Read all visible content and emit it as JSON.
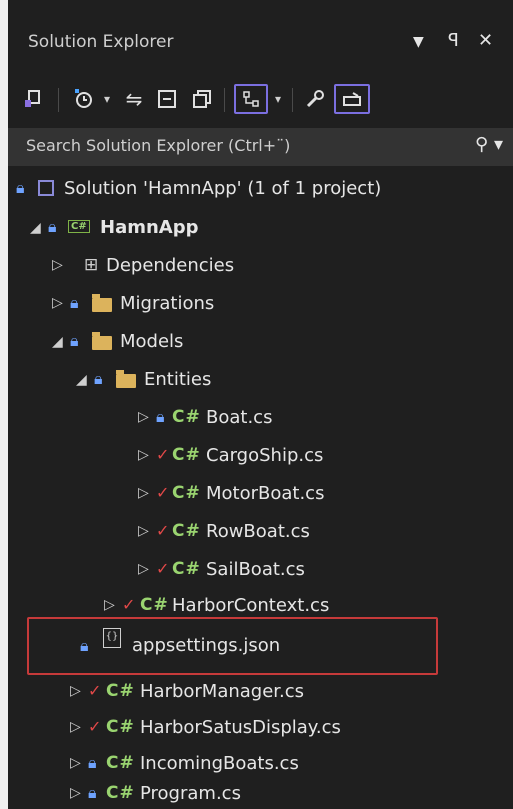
{
  "panel": {
    "title": "Solution Explorer",
    "pin_glyph": "▾",
    "pushpin_glyph": "⚲",
    "close_glyph": "✕"
  },
  "toolbar": {
    "icons": [
      "switch-views-icon",
      "history-icon",
      "sync-icon",
      "collapse-all-icon",
      "show-all-files-icon",
      "git-changes-icon",
      "properties-icon",
      "preview-icon"
    ]
  },
  "search": {
    "placeholder": "Search Solution Explorer (Ctrl+¨)",
    "icon": "search-icon"
  },
  "tree": {
    "solution": "Solution 'HamnApp' (1 of 1 project)",
    "project": "HamnApp",
    "dependencies": "Dependencies",
    "migrations": "Migrations",
    "models": "Models",
    "entities": "Entities",
    "boat": "Boat.cs",
    "cargoship": "CargoShip.cs",
    "motorboat": "MotorBoat.cs",
    "rowboat": "RowBoat.cs",
    "sailboat": "SailBoat.cs",
    "harborcontext": "HarborContext.cs",
    "appsettings": "appsettings.json",
    "harbormanager": "HarborManager.cs",
    "harborstatus": "HarborSatusDisplay.cs",
    "incoming": "IncomingBoats.cs",
    "program": "Program.cs"
  },
  "colors": {
    "accent": "#7b6fe0",
    "highlight": "#c63a3a",
    "lock": "#6fa3ff",
    "check": "#e04848",
    "csharp": "#9ad470",
    "folder": "#dcb35c"
  }
}
